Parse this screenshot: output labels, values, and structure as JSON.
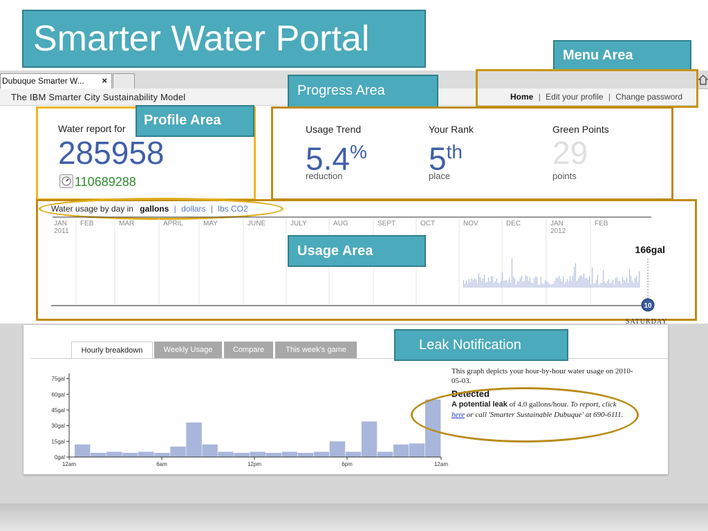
{
  "slide": {
    "title": "Smarter Water Portal",
    "callouts": {
      "menu": "Menu Area",
      "progress": "Progress Area",
      "profile": "Profile Area",
      "usage": "Usage Area",
      "leak": "Leak Notification"
    }
  },
  "browser": {
    "tab_title": "Dubuque Smarter W...",
    "tab_close": "×"
  },
  "header": {
    "model_title": "The IBM Smarter City Sustainability Model",
    "nav": {
      "home": "Home",
      "sep1": "|",
      "edit_profile": "Edit your profile",
      "sep2": "|",
      "change_password": "Change password"
    }
  },
  "profile": {
    "label": "Water report for",
    "account_number": "285958",
    "meter_number": "110689288"
  },
  "progress": {
    "usage_trend": {
      "label": "Usage Trend",
      "value": "5.4",
      "unit": "%",
      "caption": "reduction"
    },
    "rank": {
      "label": "Your Rank",
      "value": "5",
      "suffix": "th",
      "caption": "place"
    },
    "green_points": {
      "label": "Green Points",
      "value": "29",
      "caption": "points"
    }
  },
  "usage": {
    "label_prefix": "Water usage by day in",
    "units": [
      "gallons",
      "dollars",
      "lbs CO2"
    ],
    "separator": "|",
    "months": [
      "JAN",
      "FEB",
      "MAR",
      "APRIL",
      "MAY",
      "JUNE",
      "JULY",
      "AUG",
      "SEPT",
      "OCT",
      "NOV",
      "DEC",
      "JAN",
      "FEB"
    ],
    "years": [
      "2011",
      "2012"
    ],
    "current_value": "166gal",
    "marker": "10",
    "day_label": "SATURDAY"
  },
  "bottom_tabs": [
    "Hourly breakdown",
    "Weekly Usage",
    "Compare",
    "This week's game"
  ],
  "chart_data": {
    "type": "bar",
    "categories": [
      "12am",
      "1am",
      "2am",
      "3am",
      "4am",
      "5am",
      "6am",
      "7am",
      "8am",
      "9am",
      "10am",
      "11am",
      "12pm",
      "1pm",
      "2pm",
      "3pm",
      "4pm",
      "5pm",
      "6pm",
      "7pm",
      "8pm",
      "9pm",
      "10pm",
      "11pm"
    ],
    "values": [
      12,
      4,
      5,
      4,
      5,
      4,
      10,
      33,
      12,
      5,
      4,
      5,
      4,
      5,
      4,
      5,
      15,
      5,
      34,
      5,
      12,
      13,
      55
    ],
    "y_ticks": [
      "75gal",
      "60gal",
      "45gal",
      "30gal",
      "15gal",
      "0gal"
    ],
    "x_ticks": [
      "12am",
      "6am",
      "12pm",
      "6pm",
      "12am"
    ],
    "ylim": [
      0,
      80
    ],
    "bar_color": "#a9b6dc"
  },
  "leak": {
    "intro": "This graph depicts your hour-by-hour water usage on",
    "date": "2010-05-03.",
    "heading": "Detected",
    "lead_bold": "A potential leak",
    "lead_rest": "of 4.0 gallons/hour.",
    "report_italic": "To report, click",
    "link": "here",
    "rest": "or call 'Smarter Sustainable Dubuque' at 690-6111."
  }
}
